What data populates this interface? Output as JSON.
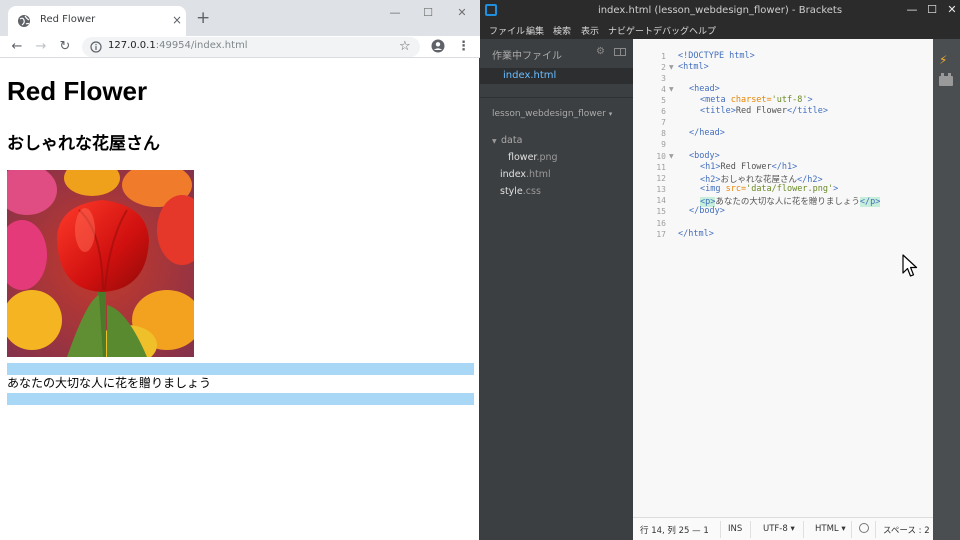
{
  "browser": {
    "tab": {
      "title": "Red Flower",
      "close_glyph": "×",
      "favicon": "globe-icon"
    },
    "new_tab_glyph": "+",
    "window_controls": {
      "minimize": "—",
      "maximize": "☐",
      "close": "✕"
    },
    "nav": {
      "back": "←",
      "forward": "→",
      "reload": "↻"
    },
    "url_host": "127.0.0.1",
    "url_rest": ":49954/index.html",
    "star_glyph": "☆",
    "menu_glyph": "⋮",
    "page": {
      "h1": "Red Flower",
      "h2": "おしゃれな花屋さん",
      "image": "tulip-photo",
      "paragraph": "あなたの大切な人に花を贈りましょう",
      "colors": {
        "margin_highlight": "#a8d8f6"
      }
    }
  },
  "brackets": {
    "window_title": "index.html (lesson_webdesign_flower) - Brackets",
    "window_controls": {
      "minimize": "—",
      "maximize": "☐",
      "close": "✕"
    },
    "menus": [
      "ファイル",
      "編集",
      "検索",
      "表示",
      "ナビゲート",
      "デバッグ",
      "ヘルプ"
    ],
    "sidebar": {
      "working_files_header": "作業中ファイル",
      "working_files": [
        {
          "name": "index.html"
        }
      ],
      "project_title": "lesson_webdesign_flower",
      "project_dropdown_glyph": "▾",
      "tree": {
        "folder": "data",
        "folder_children": [
          {
            "name": "flower",
            "ext": ".png"
          }
        ],
        "files": [
          {
            "name": "index",
            "ext": ".html"
          },
          {
            "name": "style",
            "ext": ".css"
          }
        ]
      }
    },
    "editor": {
      "lines": [
        {
          "n": "1"
        },
        {
          "n": "2"
        },
        {
          "n": "3"
        },
        {
          "n": "4"
        },
        {
          "n": "5"
        },
        {
          "n": "6"
        },
        {
          "n": "7"
        },
        {
          "n": "8"
        },
        {
          "n": "9"
        },
        {
          "n": "10"
        },
        {
          "n": "11"
        },
        {
          "n": "12"
        },
        {
          "n": "13"
        },
        {
          "n": "14"
        },
        {
          "n": "15"
        },
        {
          "n": "16"
        },
        {
          "n": "17"
        }
      ],
      "code": {
        "l1": "<!DOCTYPE html>",
        "l2": "<html>",
        "l4": "<head>",
        "l5_open": "<meta ",
        "l5_attr": "charset=",
        "l5_val": "'utf-8'",
        "l5_close": ">",
        "l6_open": "<title>",
        "l6_text": "Red Flower",
        "l6_close": "</title>",
        "l8": "</head>",
        "l10": "<body>",
        "l11_open": "<h1>",
        "l11_text": "Red Flower",
        "l11_close": "</h1>",
        "l12_open": "<h2>",
        "l12_text": "おしゃれな花屋さん",
        "l12_close": "</h2>",
        "l13_open": "<img ",
        "l13_attr": "src=",
        "l13_val": "'data/flower.png'",
        "l13_close": ">",
        "l14_open": "<p>",
        "l14_text": "あなたの大切な人に花を贈りましょう",
        "l14_close": "</p>",
        "l15": "</body>",
        "l17": "</html>"
      },
      "colors": {
        "tag": "#446fbd",
        "attr": "#e88501",
        "string": "#6a8a25",
        "match_highlight": "#c5eedb"
      }
    },
    "statusbar": {
      "cursor_pos": "行 14, 列 25 — 1",
      "mode": "INS",
      "encoding": "UTF-8",
      "language": "HTML",
      "spaces": "スペース : 2",
      "dropdown_glyph": "▾"
    },
    "toolbar_icons": [
      "live-preview-icon",
      "extension-manager-icon"
    ]
  }
}
